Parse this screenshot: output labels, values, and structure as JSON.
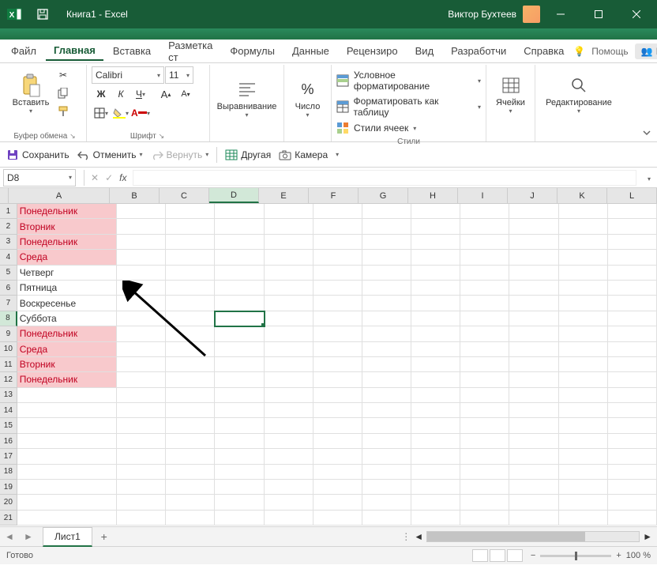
{
  "titlebar": {
    "doc": "Книга1",
    "app": "Excel",
    "title": "Книга1 - Excel",
    "user": "Виктор Бухтеев"
  },
  "menu": {
    "tabs": [
      "Файл",
      "Главная",
      "Вставка",
      "Разметка ст",
      "Формулы",
      "Данные",
      "Рецензиро",
      "Вид",
      "Разработчи",
      "Справка"
    ],
    "active": 1,
    "help": "Помощь",
    "share": "Поделиться"
  },
  "ribbon": {
    "clipboard": {
      "paste": "Вставить",
      "label": "Буфер обмена"
    },
    "font": {
      "name": "Calibri",
      "size": "11",
      "bold": "Ж",
      "italic": "К",
      "underline": "Ч",
      "label": "Шрифт"
    },
    "alignment": {
      "label": "Выравнивание"
    },
    "number": {
      "label": "Число",
      "symbol": "%"
    },
    "styles": {
      "cond": "Условное форматирование",
      "table": "Форматировать как таблицу",
      "cell": "Стили ячеек",
      "label": "Стили"
    },
    "cells": {
      "label": "Ячейки"
    },
    "editing": {
      "label": "Редактирование"
    }
  },
  "qat": {
    "save": "Сохранить",
    "undo": "Отменить",
    "redo": "Вернуть",
    "other": "Другая",
    "camera": "Камера"
  },
  "namebox": {
    "ref": "D8",
    "fx": "fx"
  },
  "columns": [
    "A",
    "B",
    "C",
    "D",
    "E",
    "F",
    "G",
    "H",
    "I",
    "J",
    "K",
    "L"
  ],
  "rows": [
    {
      "n": 1,
      "a": "Понедельник",
      "hl": true
    },
    {
      "n": 2,
      "a": "Вторник",
      "hl": true
    },
    {
      "n": 3,
      "a": "Понедельник",
      "hl": true
    },
    {
      "n": 4,
      "a": "Среда",
      "hl": true
    },
    {
      "n": 5,
      "a": "Четверг",
      "hl": false
    },
    {
      "n": 6,
      "a": "Пятница",
      "hl": false
    },
    {
      "n": 7,
      "a": "Воскресенье",
      "hl": false
    },
    {
      "n": 8,
      "a": "Суббота",
      "hl": false
    },
    {
      "n": 9,
      "a": "Понедельник",
      "hl": true
    },
    {
      "n": 10,
      "a": "Среда",
      "hl": true
    },
    {
      "n": 11,
      "a": "Вторник",
      "hl": true
    },
    {
      "n": 12,
      "a": "Понедельник",
      "hl": true
    }
  ],
  "empty_rows": [
    13,
    14,
    15,
    16,
    17,
    18,
    19,
    20,
    21
  ],
  "active_cell": {
    "row": 8,
    "col": "D"
  },
  "sheet": {
    "name": "Лист1"
  },
  "status": {
    "ready": "Готово",
    "zoom": "100 %"
  }
}
